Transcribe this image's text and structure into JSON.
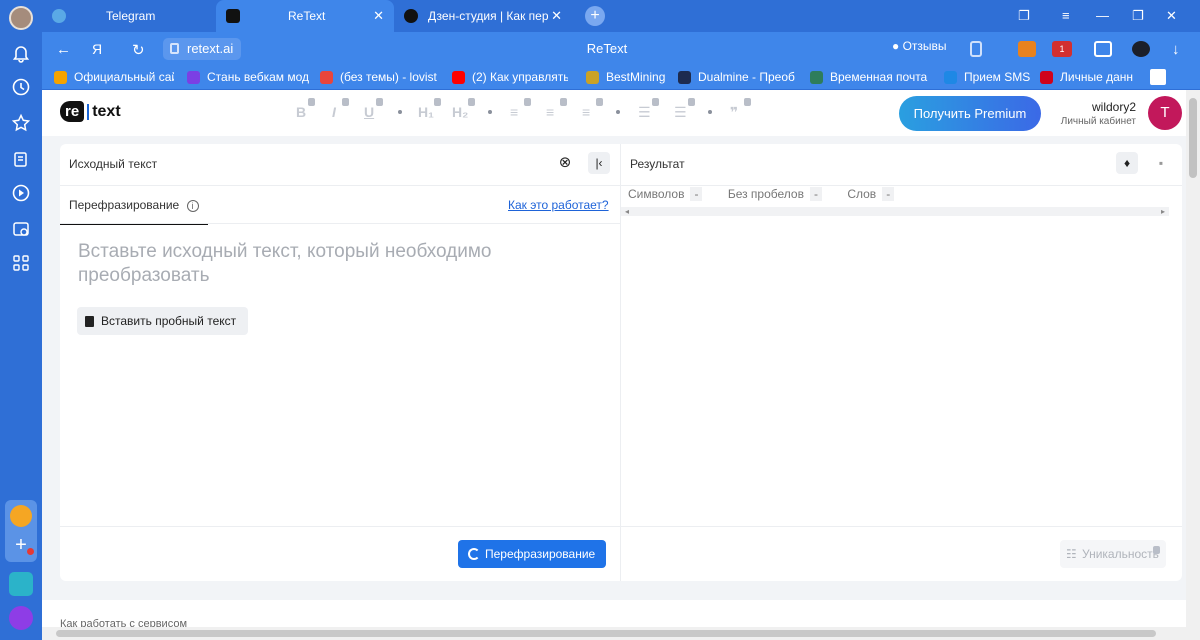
{
  "browser": {
    "tabs": [
      {
        "title": "Telegram",
        "icon": "telegram-icon"
      },
      {
        "title": "ReText",
        "icon": "retext-icon",
        "active": true
      },
      {
        "title": "Дзен-студия | Как перефр",
        "icon": "dzen-icon"
      }
    ],
    "new_tab": "+",
    "address": {
      "url": "retext.ai",
      "page_title": "ReText",
      "reviews": "Отзывы"
    },
    "bookmarks": [
      {
        "label": "Официальный сай",
        "color": "#f4a300"
      },
      {
        "label": "Стань вебкам мод",
        "color": "#7b3fe4"
      },
      {
        "label": "(без темы) - lovist",
        "color": "#e8453c"
      },
      {
        "label": "(2) Как управлять",
        "color": "#ff0000"
      },
      {
        "label": "BestMining",
        "color": "#c9a227"
      },
      {
        "label": "Dualmine - Преоб",
        "color": "#1d2b4f"
      },
      {
        "label": "Временная почта",
        "color": "#2e7d5b"
      },
      {
        "label": "Прием SMS",
        "color": "#1e88e5"
      },
      {
        "label": "Личные данн",
        "color": "#d0021b"
      }
    ],
    "extension_badge": "1"
  },
  "app": {
    "logo_re": "re",
    "logo_text": "text",
    "premium_button": "Получить Premium",
    "user": {
      "name": "wildory2",
      "subtitle": "Личный кабинет",
      "avatar_letter": "T"
    }
  },
  "source_panel": {
    "title": "Исходный текст",
    "tab_label": "Перефразирование",
    "help_link": "Как это работает?",
    "placeholder": "Вставьте исходный текст, который необходимо преобразовать",
    "sample_button": "Вставить пробный текст",
    "action_button": "Перефразирование"
  },
  "result_panel": {
    "title": "Результат",
    "stats": [
      {
        "label": "Символов",
        "value": "-"
      },
      {
        "label": "Без пробелов",
        "value": "-"
      },
      {
        "label": "Слов",
        "value": "-"
      }
    ],
    "uniqueness_button": "Уникальность"
  },
  "footer": {
    "text": "Как работать с сервисом"
  }
}
